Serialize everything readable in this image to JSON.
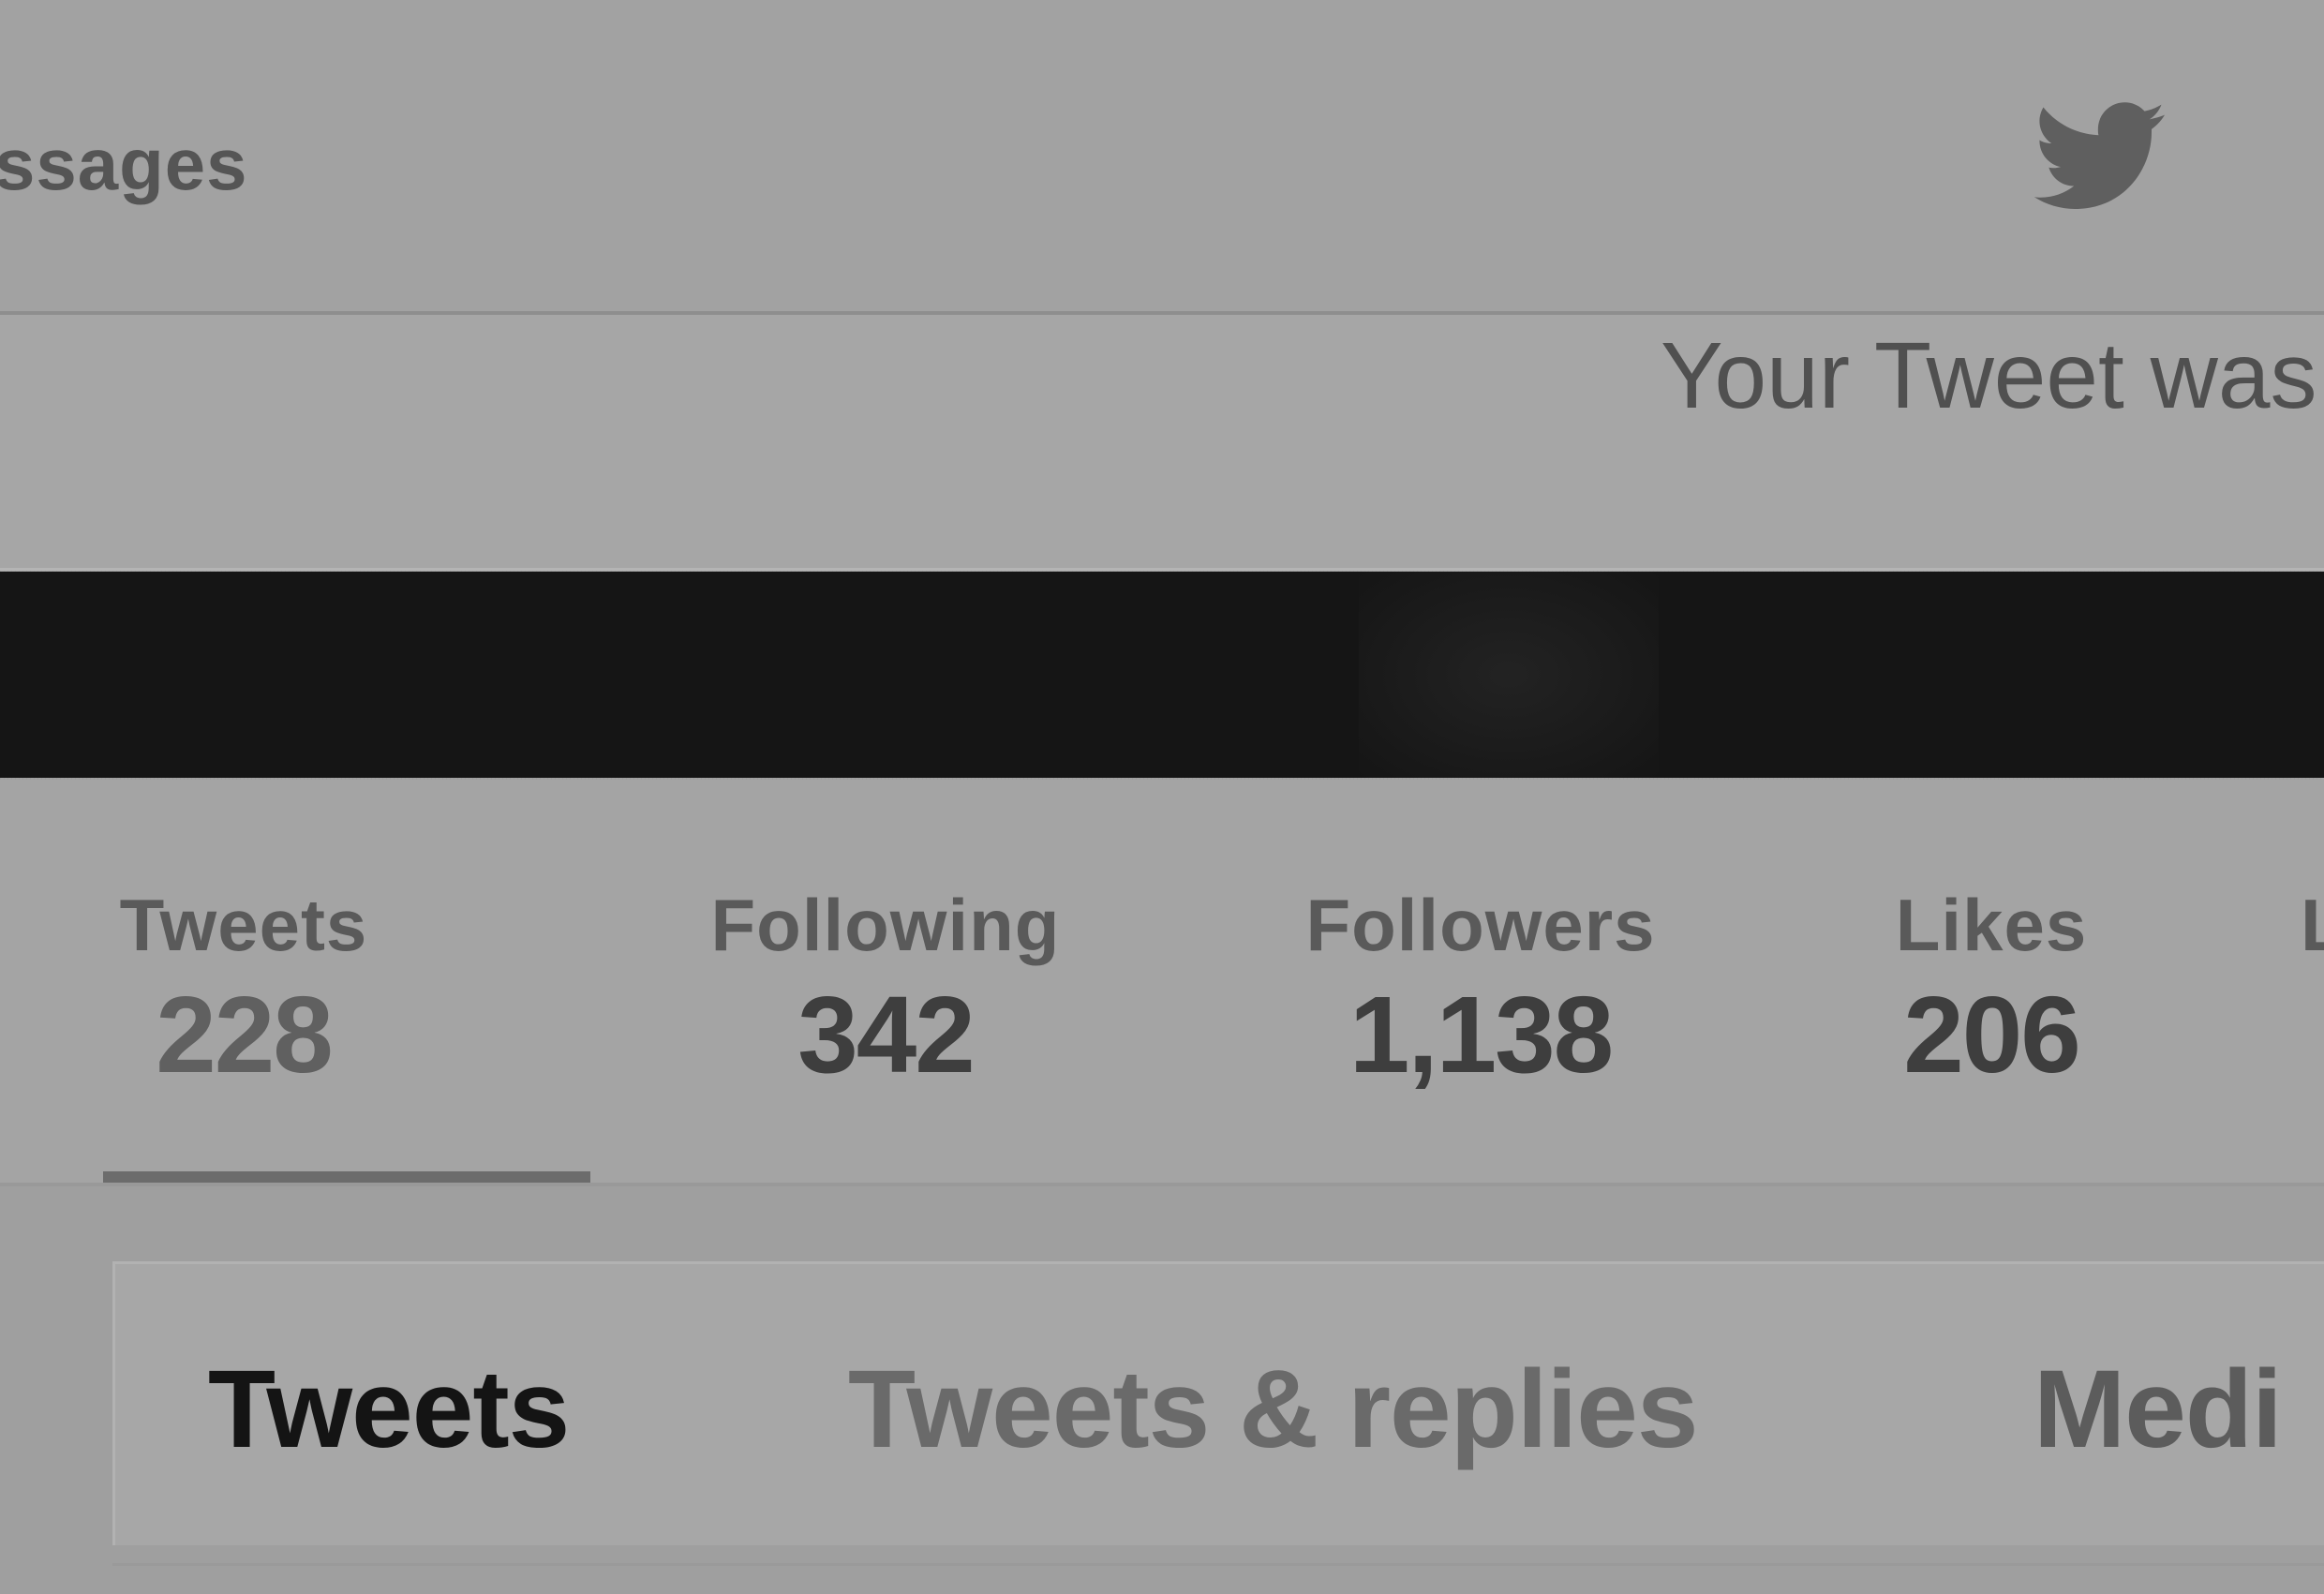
{
  "topnav": {
    "messages_label": "ssages",
    "logo_icon": "twitter-bird-icon"
  },
  "notification": {
    "text": "Your Tweet was"
  },
  "profile_stats": [
    {
      "label": "Tweets",
      "value": "228"
    },
    {
      "label": "Following",
      "value": "342"
    },
    {
      "label": "Followers",
      "value": "1,138"
    },
    {
      "label": "Likes",
      "value": "206"
    }
  ],
  "profile_stats_cutoff": "L",
  "timeline_tabs": [
    {
      "label": "Tweets"
    },
    {
      "label": "Tweets & replies"
    },
    {
      "label": "Medi"
    }
  ],
  "colors": {
    "background": "#a3a3a3",
    "banner": "#151515",
    "active_tab_text": "#141414"
  }
}
